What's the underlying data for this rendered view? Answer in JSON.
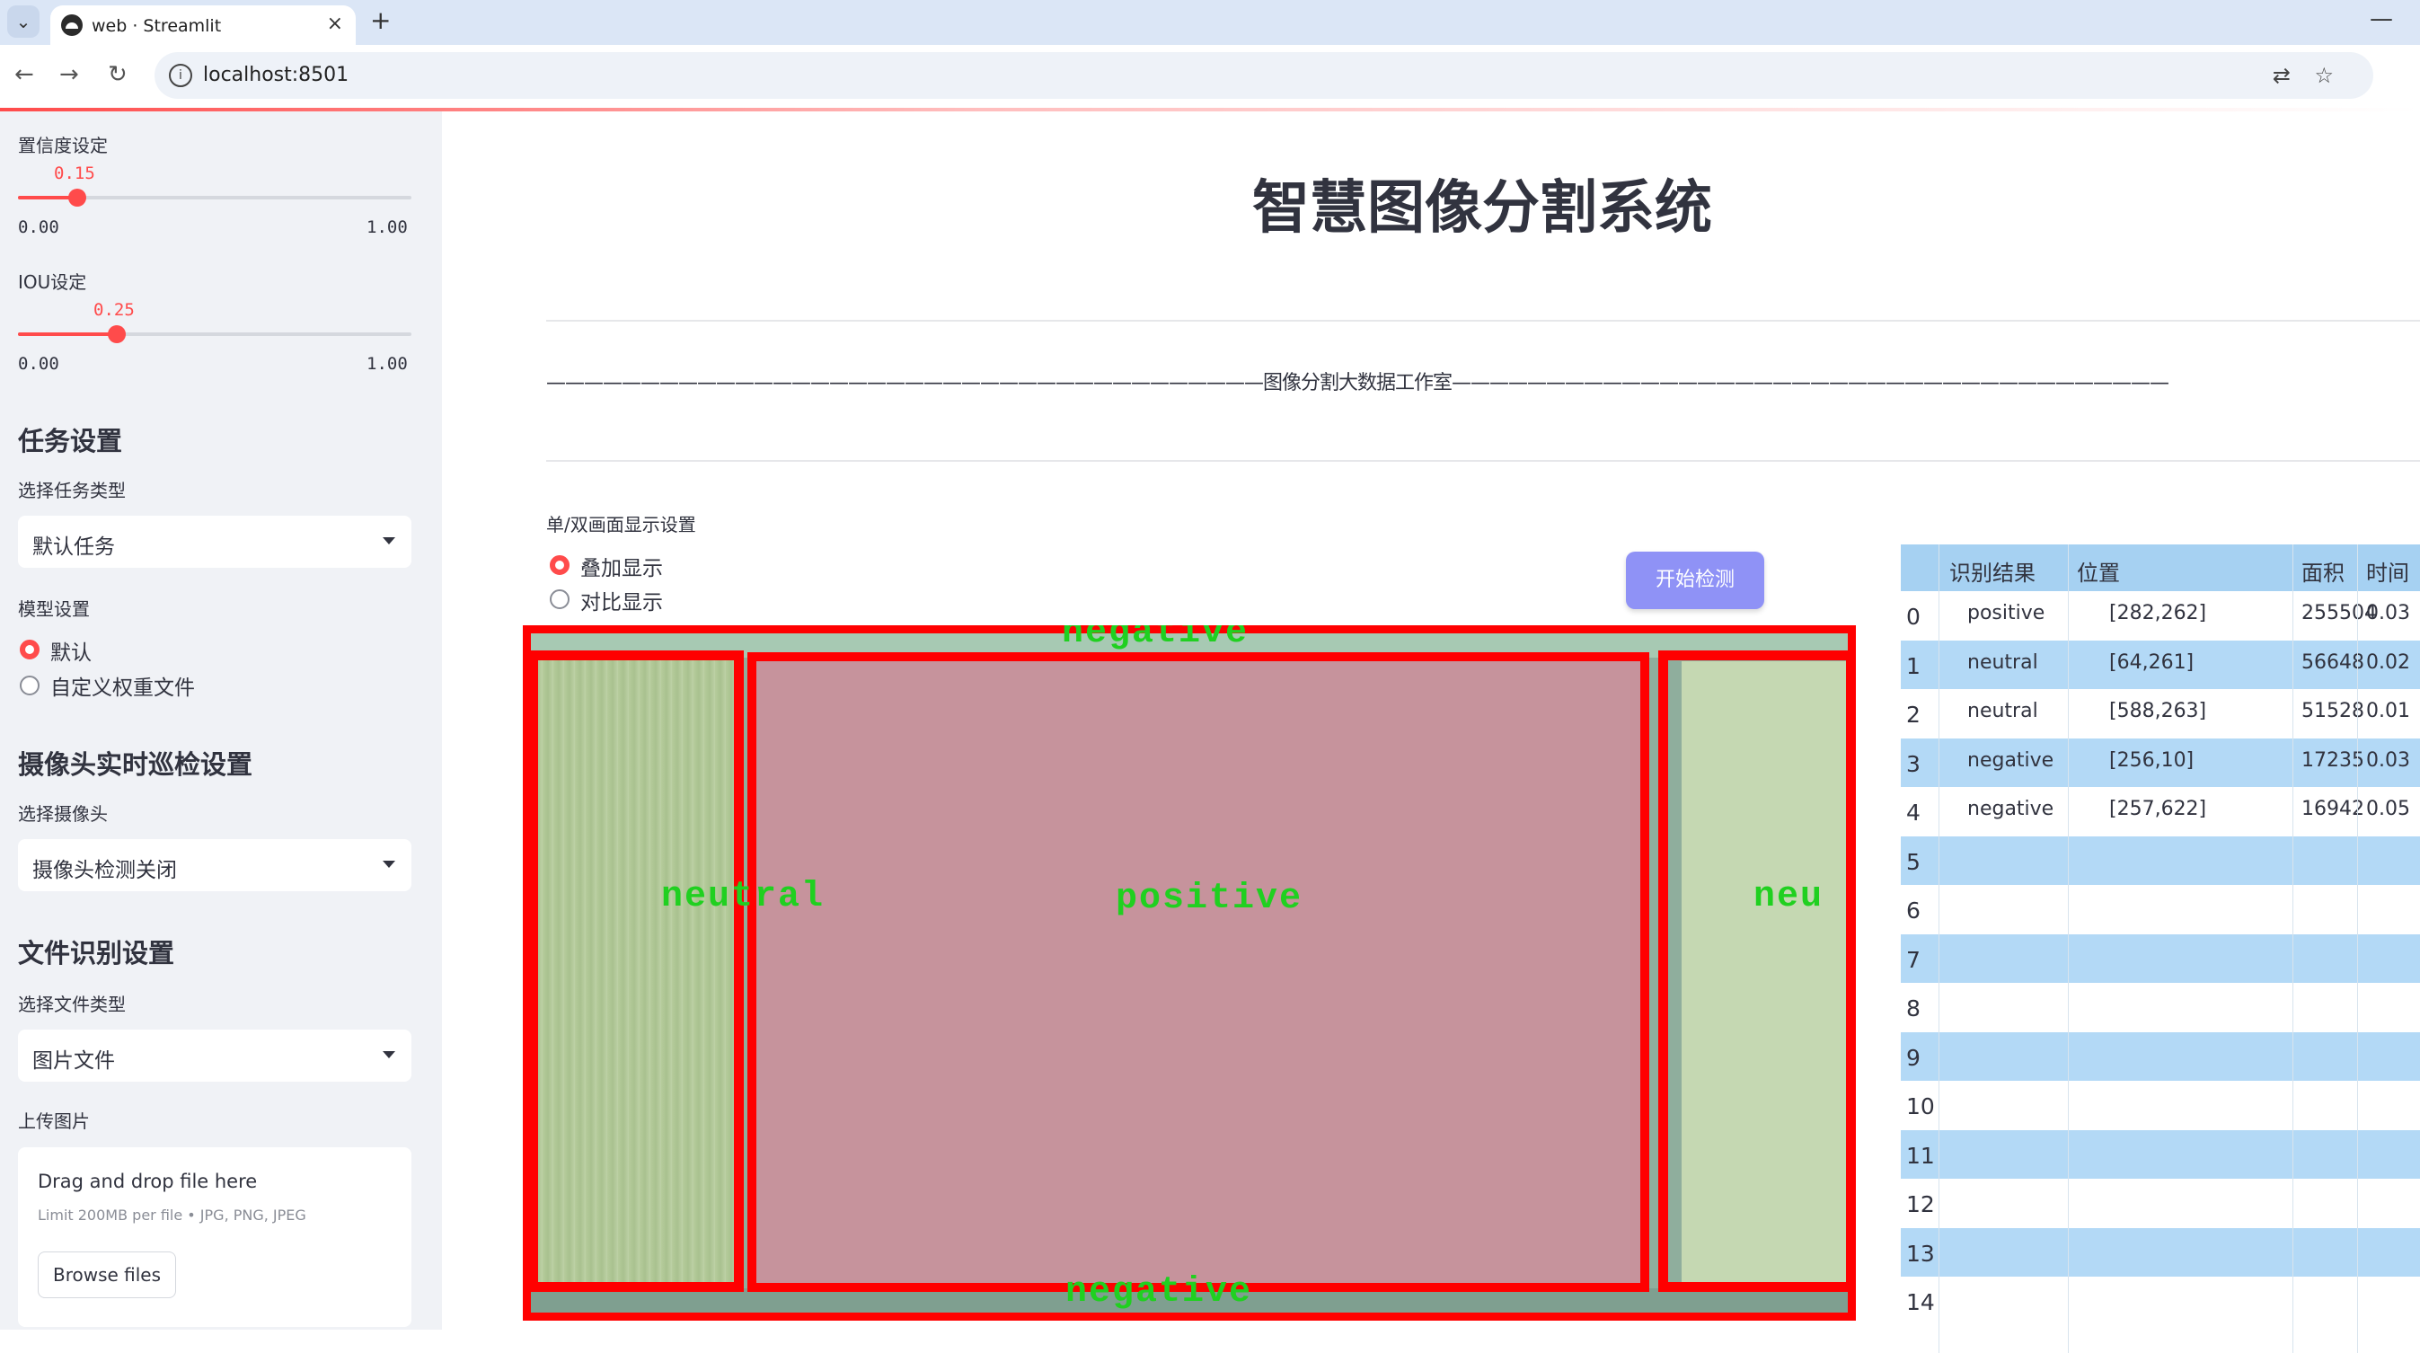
{
  "browser": {
    "tab_title": "web · Streamlit",
    "url": "localhost:8501",
    "new_tab": "+",
    "close": "×",
    "minimize": "—"
  },
  "sidebar": {
    "confidence": {
      "label": "置信度设定",
      "value": "0.15",
      "min": "0.00",
      "max": "1.00",
      "level": 0.15
    },
    "iou": {
      "label": "IOU设定",
      "value": "0.25",
      "min": "0.00",
      "max": "1.00",
      "level": 0.25
    },
    "task_section": "任务设置",
    "task_type_label": "选择任务类型",
    "task_type_value": "默认任务",
    "model_label": "模型设置",
    "model_options": [
      "默认",
      "自定义权重文件"
    ],
    "camera_section": "摄像头实时巡检设置",
    "camera_label": "选择摄像头",
    "camera_value": "摄像头检测关闭",
    "file_section": "文件识别设置",
    "file_type_label": "选择文件类型",
    "file_type_value": "图片文件",
    "upload_label": "上传图片",
    "upload_title": "Drag and drop file here",
    "upload_limit": "Limit 200MB per file • JPG, PNG, JPEG",
    "browse_button": "Browse files"
  },
  "main": {
    "title": "智慧图像分割系统",
    "subtitle": "——————————————————————————————————————图像分割大数据工作室——————————————————————————————————————",
    "display_label": "单/双画面显示设置",
    "display_options": [
      "叠加显示",
      "对比显示"
    ],
    "start_button": "开始检测"
  },
  "segmentation": {
    "labels": [
      "negative",
      "neutral",
      "positive",
      "neu",
      "negative"
    ]
  },
  "table": {
    "headers": [
      "识别结果",
      "位置",
      "面积",
      "时间"
    ],
    "rows": [
      [
        "0",
        "positive",
        "[282,262]",
        "255504",
        "0.03"
      ],
      [
        "1",
        "neutral",
        "[64,261]",
        "56648",
        "0.02"
      ],
      [
        "2",
        "neutral",
        "[588,263]",
        "51528",
        "0.01"
      ],
      [
        "3",
        "negative",
        "[256,10]",
        "17235",
        "0.03"
      ],
      [
        "4",
        "negative",
        "[257,622]",
        "16942",
        "0.05"
      ],
      [
        "5",
        "",
        "",
        "",
        ""
      ],
      [
        "6",
        "",
        "",
        "",
        ""
      ],
      [
        "7",
        "",
        "",
        "",
        ""
      ],
      [
        "8",
        "",
        "",
        "",
        ""
      ],
      [
        "9",
        "",
        "",
        "",
        ""
      ],
      [
        "10",
        "",
        "",
        "",
        ""
      ],
      [
        "11",
        "",
        "",
        "",
        ""
      ],
      [
        "12",
        "",
        "",
        "",
        ""
      ],
      [
        "13",
        "",
        "",
        "",
        ""
      ],
      [
        "14",
        "",
        "",
        "",
        ""
      ]
    ]
  },
  "colors": {
    "accent": "#ff4b4b",
    "button": "#8f92f6",
    "table_header": "#a6d1f2",
    "table_stripe": "#b3d9f6"
  }
}
